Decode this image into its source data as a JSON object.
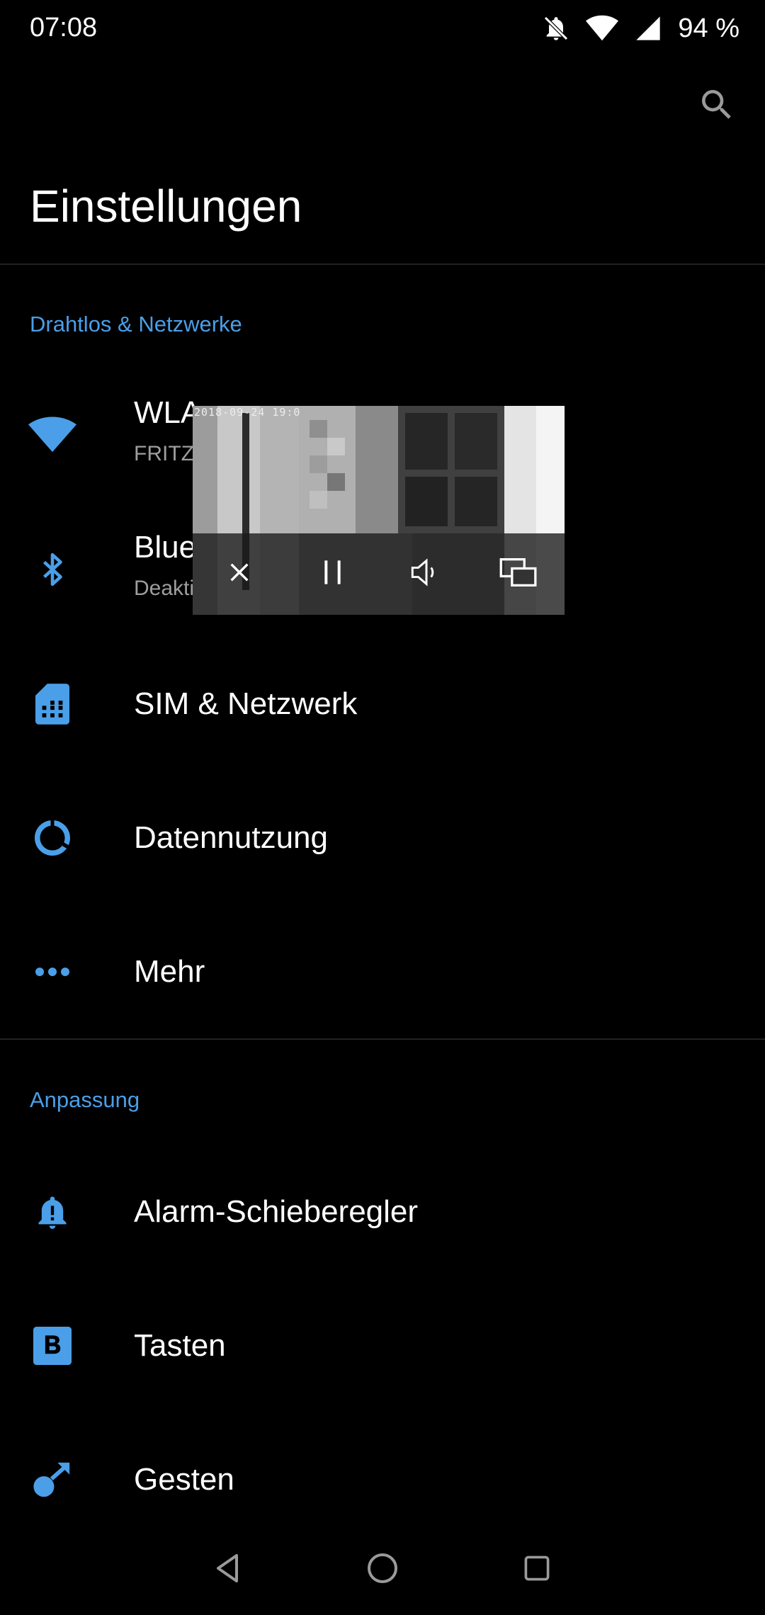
{
  "status_bar": {
    "time": "07:08",
    "battery": "94 %",
    "icons": [
      "bell-off-icon",
      "wifi-icon",
      "cellular-signal-icon"
    ]
  },
  "toolbar": {
    "title": "Einstellungen",
    "search_icon": "search-icon"
  },
  "sections": [
    {
      "header": "Drahtlos & Netzwerke",
      "items": [
        {
          "label": "WLAN",
          "visible_label": "WLA",
          "subtitle": "FRITZ!",
          "icon": "wifi-icon"
        },
        {
          "label": "Bluetooth",
          "visible_label": "Blue",
          "subtitle": "Deakti",
          "icon": "bluetooth-icon"
        },
        {
          "label": "SIM & Netzwerk",
          "icon": "sim-card-icon"
        },
        {
          "label": "Datennutzung",
          "icon": "data-usage-icon"
        },
        {
          "label": "Mehr",
          "icon": "more-dots-icon"
        }
      ]
    },
    {
      "header": "Anpassung",
      "items": [
        {
          "label": "Alarm-Schieberegler",
          "icon": "alert-bell-icon"
        },
        {
          "label": "Tasten",
          "icon": "buttons-b-icon"
        },
        {
          "label": "Gesten",
          "icon": "gesture-icon"
        }
      ]
    }
  ],
  "pip": {
    "timestamp": "2018-09-24 19:0",
    "controls": [
      "close-icon",
      "pause-icon",
      "volume-icon",
      "fullscreen-icon"
    ]
  },
  "nav_bar": [
    "back-icon",
    "home-icon",
    "recents-icon"
  ],
  "colors": {
    "accent": "#4a9fe8",
    "background": "#000000",
    "subtitle": "#9e9e9e"
  }
}
